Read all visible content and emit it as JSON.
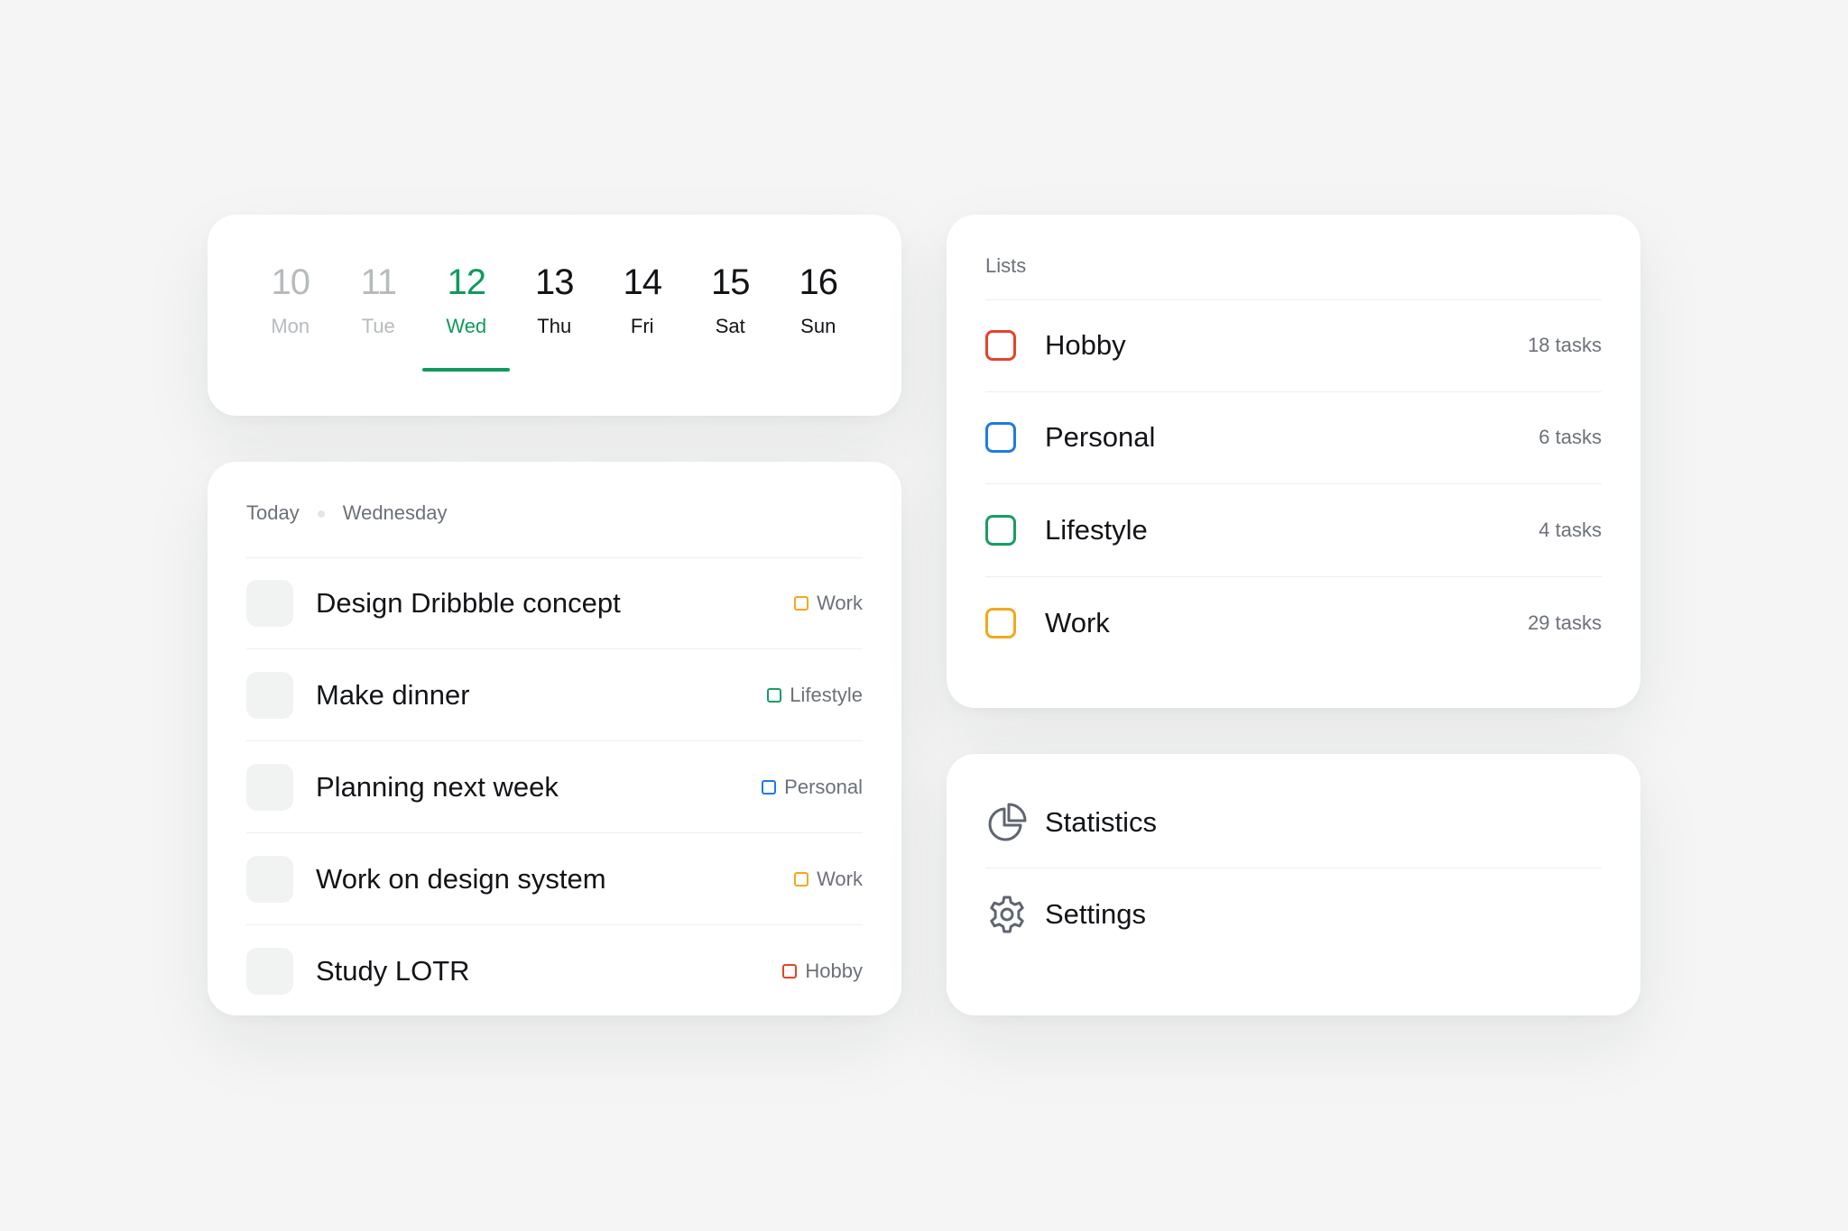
{
  "calendar": {
    "days": [
      {
        "num": "10",
        "name": "Mon",
        "state": "past"
      },
      {
        "num": "11",
        "name": "Tue",
        "state": "past"
      },
      {
        "num": "12",
        "name": "Wed",
        "state": "active"
      },
      {
        "num": "13",
        "name": "Thu",
        "state": "upcoming"
      },
      {
        "num": "14",
        "name": "Fri",
        "state": "upcoming"
      },
      {
        "num": "15",
        "name": "Sat",
        "state": "upcoming"
      },
      {
        "num": "16",
        "name": "Sun",
        "state": "upcoming"
      }
    ],
    "accent_color": "#109a5c"
  },
  "today": {
    "label": "Today",
    "weekday": "Wednesday",
    "tasks": [
      {
        "title": "Design Dribbble concept",
        "tag": "Work"
      },
      {
        "title": "Make dinner",
        "tag": "Lifestyle"
      },
      {
        "title": "Planning next week",
        "tag": "Personal"
      },
      {
        "title": "Work on design system",
        "tag": "Work"
      },
      {
        "title": "Study LOTR",
        "tag": "Hobby"
      }
    ]
  },
  "lists": {
    "title": "Lists",
    "items": [
      {
        "name": "Hobby",
        "count": "18 tasks",
        "color": "#e5432a"
      },
      {
        "name": "Personal",
        "count": "6 tasks",
        "color": "#1f7be0"
      },
      {
        "name": "Lifestyle",
        "count": "4 tasks",
        "color": "#1a9d62"
      },
      {
        "name": "Work",
        "count": "29 tasks",
        "color": "#f2a81d"
      }
    ]
  },
  "menu": {
    "items": [
      {
        "label": "Statistics",
        "icon": "pie-chart-icon"
      },
      {
        "label": "Settings",
        "icon": "gear-icon"
      }
    ]
  },
  "colors": {
    "background": "#f4f5f4",
    "card": "#ffffff",
    "text_primary": "#121417",
    "text_secondary": "#6c7178",
    "text_muted": "#b7bbbe"
  }
}
